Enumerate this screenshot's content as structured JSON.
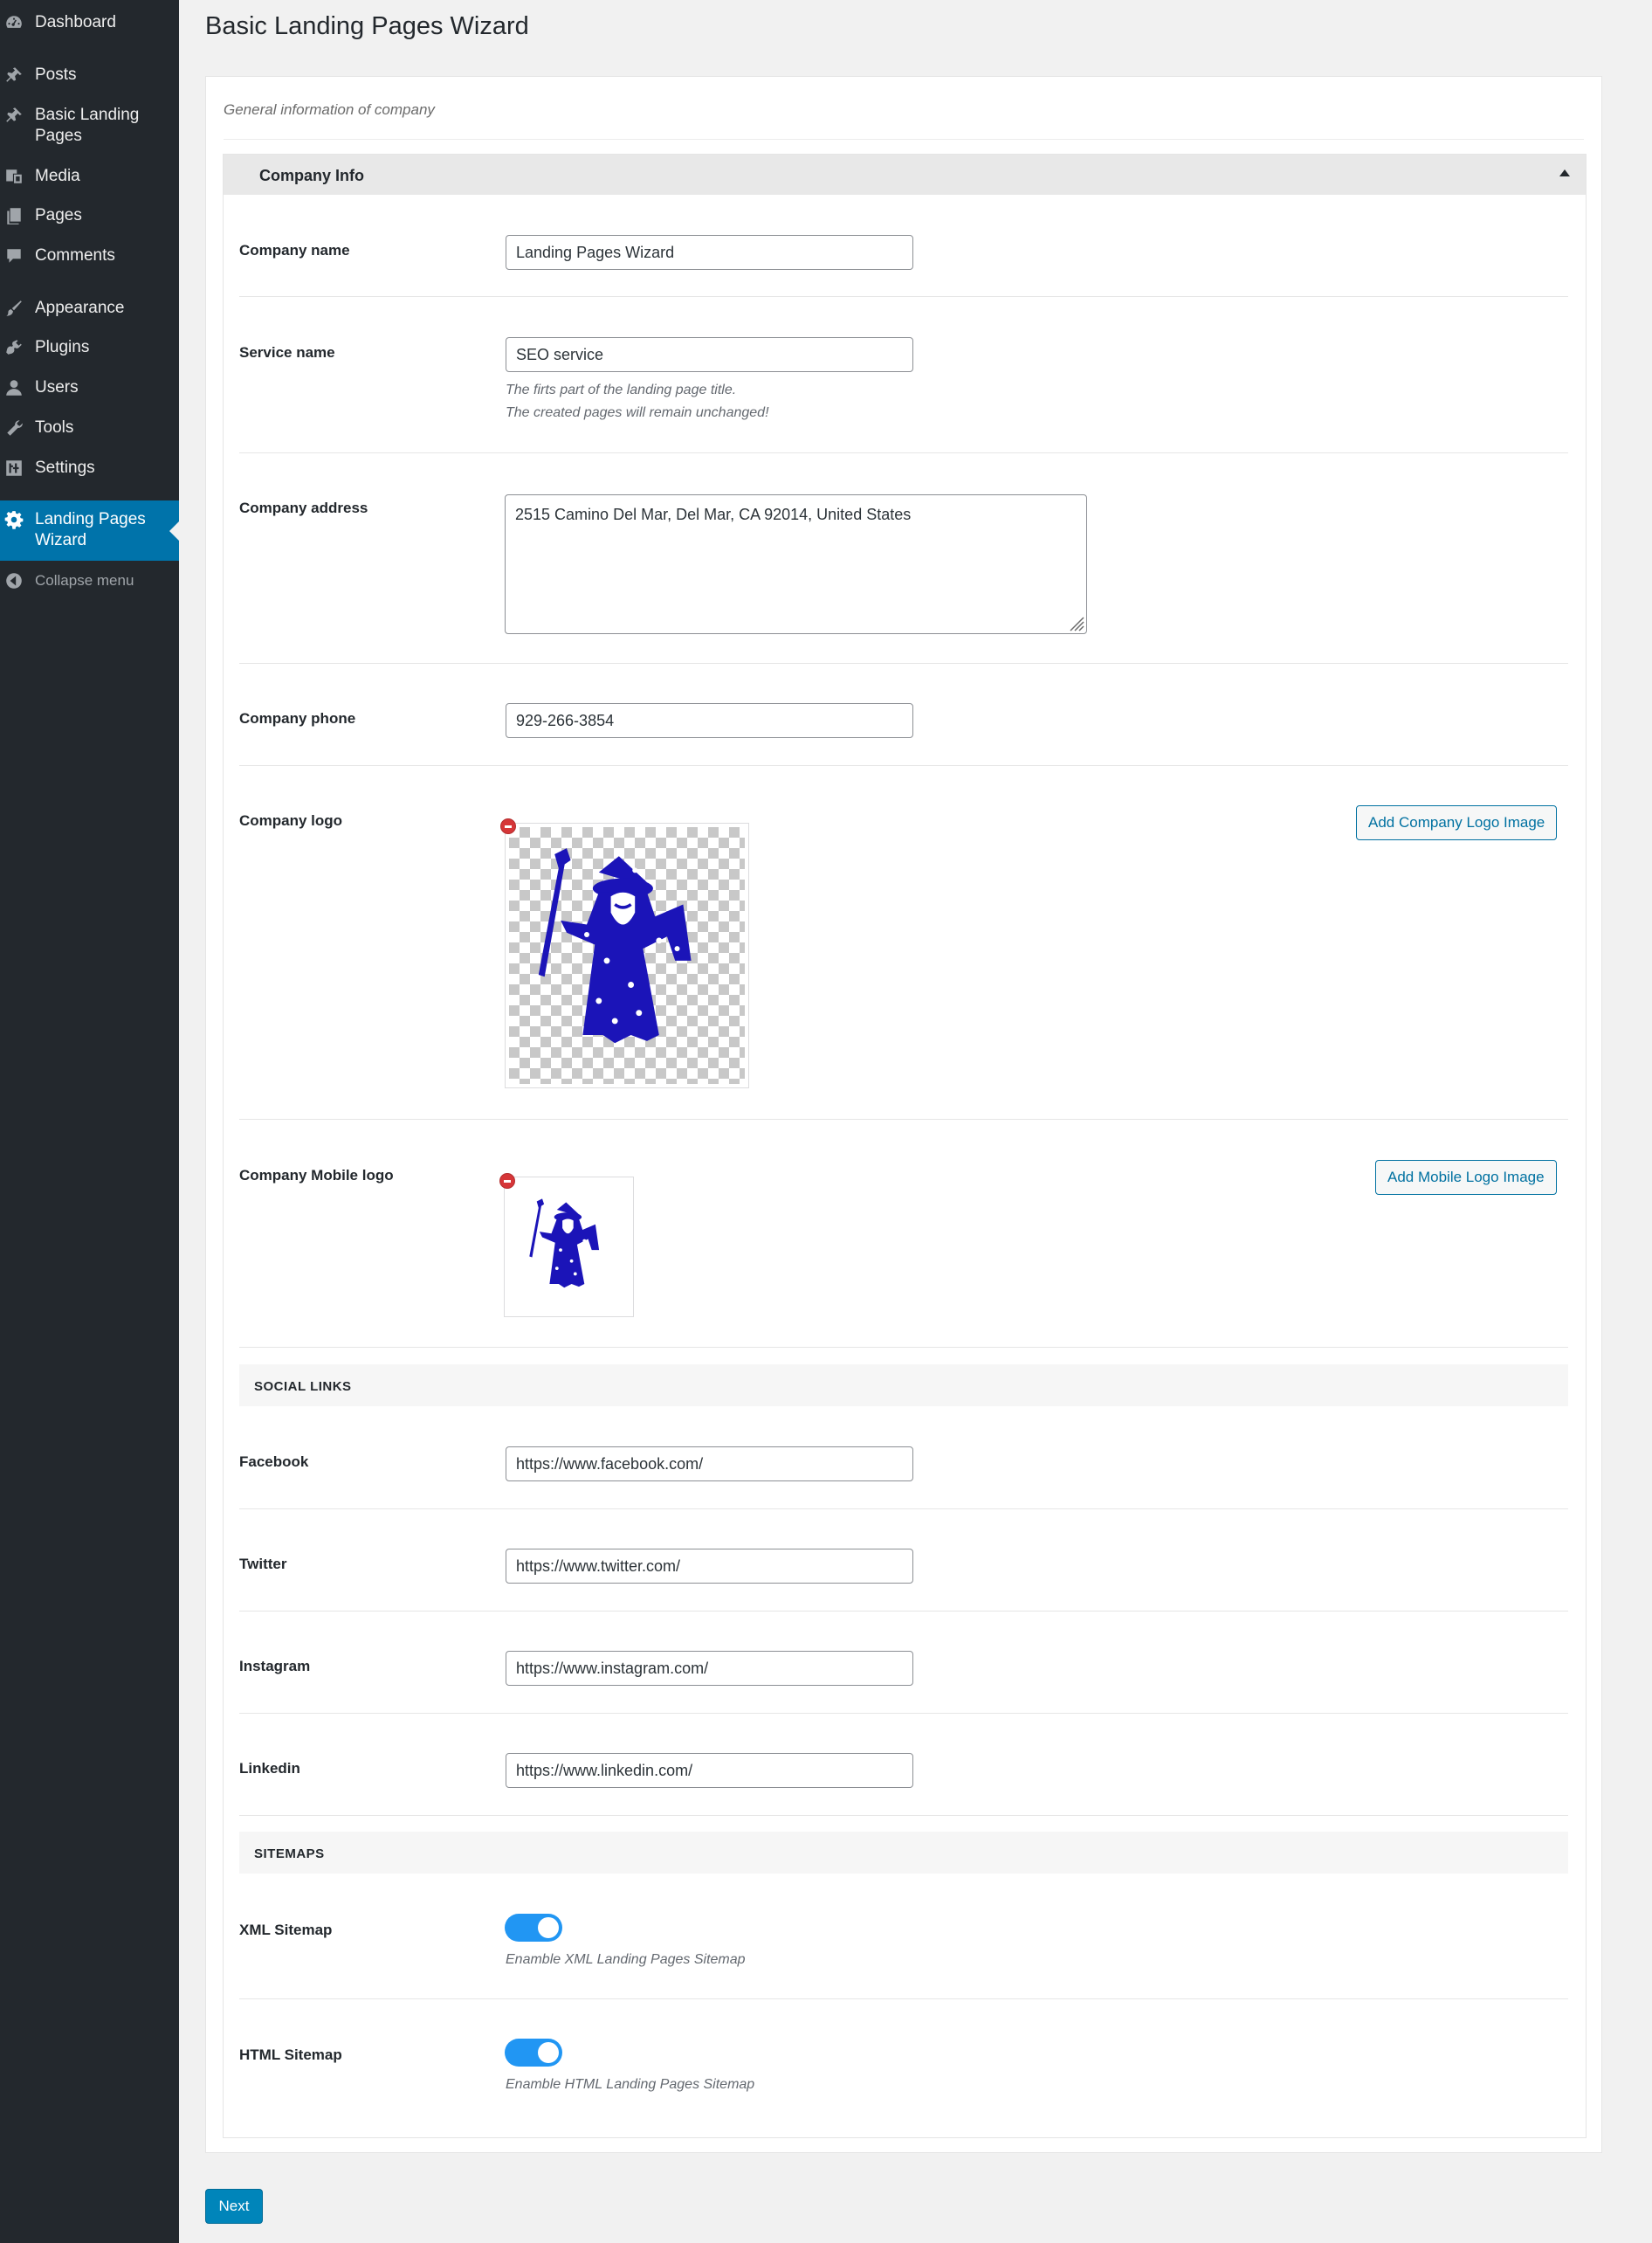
{
  "sidebar": {
    "items": [
      {
        "label": "Dashboard",
        "icon": "dashboard-icon"
      },
      {
        "label": "Posts",
        "icon": "pushpin-icon"
      },
      {
        "label": "Basic Landing Pages",
        "icon": "pushpin-icon"
      },
      {
        "label": "Media",
        "icon": "media-icon"
      },
      {
        "label": "Pages",
        "icon": "pages-icon"
      },
      {
        "label": "Comments",
        "icon": "comment-icon"
      },
      {
        "label": "Appearance",
        "icon": "paintbrush-icon"
      },
      {
        "label": "Plugins",
        "icon": "plugin-icon"
      },
      {
        "label": "Users",
        "icon": "user-icon"
      },
      {
        "label": "Tools",
        "icon": "wrench-icon"
      },
      {
        "label": "Settings",
        "icon": "settings-icon"
      },
      {
        "label": "Landing Pages Wizard",
        "icon": "gear-icon",
        "active": true
      },
      {
        "label": "Collapse menu",
        "icon": "collapse-arrow-icon"
      }
    ],
    "colors": {
      "background": "#23282d",
      "active": "#0073aa"
    }
  },
  "page": {
    "title": "Basic Landing Pages Wizard",
    "description": "General information of company"
  },
  "section": {
    "title": "Company Info",
    "expanded": true
  },
  "fields": {
    "company_name": {
      "label": "Company name",
      "value": "Landing Pages Wizard"
    },
    "service_name": {
      "label": "Service name",
      "value": "SEO service",
      "help_line1": "The firts part of the landing page title.",
      "help_line2": "The created pages will remain unchanged!"
    },
    "company_address": {
      "label": "Company address",
      "value": "2515 Camino Del Mar, Del Mar, CA 92014, United States"
    },
    "company_phone": {
      "label": "Company phone",
      "value": "929-266-3854"
    },
    "company_logo": {
      "label": "Company logo",
      "button": "Add Company Logo Image"
    },
    "company_mobile_logo": {
      "label": "Company Mobile logo",
      "button": "Add Mobile Logo Image"
    }
  },
  "social_links": {
    "header": "SOCIAL LINKS",
    "facebook": {
      "label": "Facebook",
      "value": "https://www.facebook.com/"
    },
    "twitter": {
      "label": "Twitter",
      "value": "https://www.twitter.com/"
    },
    "instagram": {
      "label": "Instagram",
      "value": "https://www.instagram.com/"
    },
    "linkedin": {
      "label": "Linkedin",
      "value": "https://www.linkedin.com/"
    }
  },
  "sitemaps": {
    "header": "SITEMAPS",
    "xml": {
      "label": "XML Sitemap",
      "enabled": true,
      "help": "Enamble XML Landing Pages Sitemap"
    },
    "html": {
      "label": "HTML Sitemap",
      "enabled": true,
      "help": "Enamble HTML Landing Pages Sitemap"
    },
    "toggle_color": "#2196f3"
  },
  "footer": {
    "next_label": "Next",
    "next_color": "#0085ba"
  },
  "logo_color": "#1b14b8"
}
